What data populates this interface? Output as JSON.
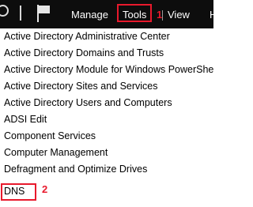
{
  "menubar": {
    "manage_label": "Manage",
    "tools_label": "Tools",
    "view_label": "View",
    "help_label": "H"
  },
  "annotations": {
    "step1": "1",
    "step2": "2"
  },
  "tools_menu": {
    "items": [
      "Active Directory Administrative Center",
      "Active Directory Domains and Trusts",
      "Active Directory Module for Windows PowerShell",
      "Active Directory Sites and Services",
      "Active Directory Users and Computers",
      "ADSI Edit",
      "Component Services",
      "Computer Management",
      "Defragment and Optimize Drives",
      "DNS"
    ]
  },
  "colors": {
    "menubar_bg": "#0d0d0d",
    "highlight": "#e8192c"
  }
}
